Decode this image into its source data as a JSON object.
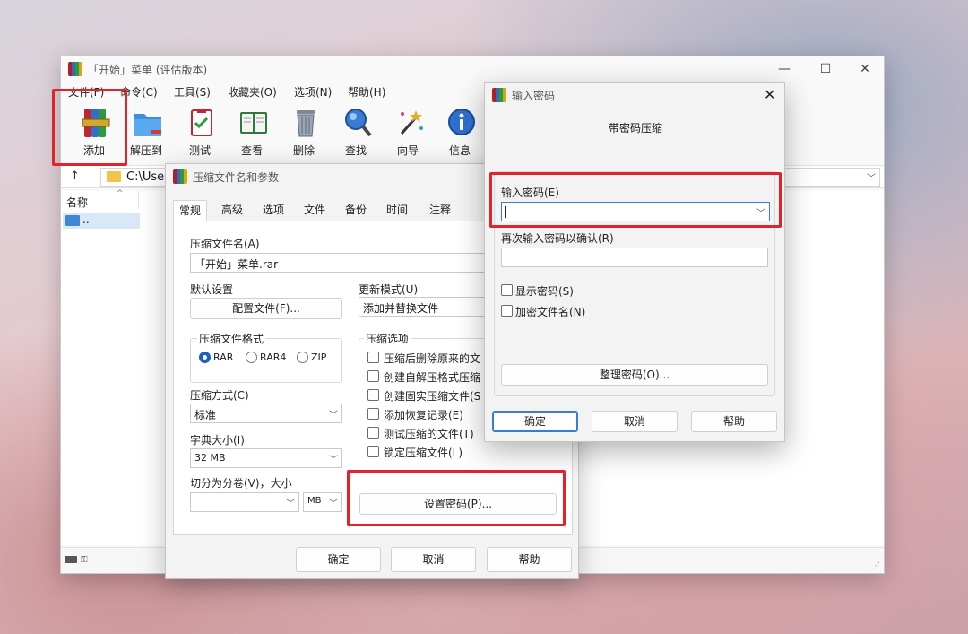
{
  "main_window": {
    "title": "「开始」菜单 (评估版本)",
    "caption": {
      "minimize": "—",
      "maximize": "☐",
      "close": "✕"
    },
    "menu": [
      "文件(F)",
      "命令(C)",
      "工具(S)",
      "收藏夹(O)",
      "选项(N)",
      "帮助(H)"
    ],
    "toolbar": [
      {
        "label": "添加",
        "icon": "add-archive-icon"
      },
      {
        "label": "解压到",
        "icon": "extract-folder-icon"
      },
      {
        "label": "测试",
        "icon": "test-icon"
      },
      {
        "label": "查看",
        "icon": "view-book-icon"
      },
      {
        "label": "删除",
        "icon": "trash-icon"
      },
      {
        "label": "查找",
        "icon": "magnifier-icon"
      },
      {
        "label": "向导",
        "icon": "wizard-wand-icon"
      },
      {
        "label": "信息",
        "icon": "info-icon"
      }
    ],
    "up_arrow": "↑",
    "address": "C:\\Use",
    "file_list": {
      "column_name": "名称",
      "rows": [
        ".."
      ]
    }
  },
  "archive_dialog": {
    "title": "压缩文件名和参数",
    "tabs": [
      "常规",
      "高级",
      "选项",
      "文件",
      "备份",
      "时间",
      "注释"
    ],
    "archive_name_label": "压缩文件名(A)",
    "archive_name_value": "「开始」菜单.rar",
    "default_settings_label": "默认设置",
    "profiles_button": "配置文件(F)...",
    "update_mode_label": "更新模式(U)",
    "update_mode_value": "添加并替换文件",
    "format_group_label": "压缩文件格式",
    "formats": [
      {
        "label": "RAR",
        "selected": true
      },
      {
        "label": "RAR4",
        "selected": false
      },
      {
        "label": "ZIP",
        "selected": false
      }
    ],
    "method_label": "压缩方式(C)",
    "method_value": "标准",
    "dict_label": "字典大小(I)",
    "dict_value": "32 MB",
    "split_label": "切分为分卷(V)，大小",
    "split_value": "",
    "split_unit": "MB",
    "options_group_label": "压缩选项",
    "options": [
      {
        "label": "压缩后删除原来的文",
        "checked": false
      },
      {
        "label": "创建自解压格式压缩",
        "checked": false
      },
      {
        "label": "创建固实压缩文件(S",
        "checked": false
      },
      {
        "label": "添加恢复记录(E)",
        "checked": false
      },
      {
        "label": "测试压缩的文件(T)",
        "checked": false
      },
      {
        "label": "锁定压缩文件(L)",
        "checked": false
      }
    ],
    "set_password_button": "设置密码(P)...",
    "ok": "确定",
    "cancel": "取消",
    "help": "帮助"
  },
  "password_dialog": {
    "title": "输入密码",
    "heading": "带密码压缩",
    "enter_label": "输入密码(E)",
    "enter_value": "",
    "confirm_label": "再次输入密码以确认(R)",
    "confirm_value": "",
    "show_password": {
      "label": "显示密码(S)",
      "checked": false
    },
    "encrypt_names": {
      "label": "加密文件名(N)",
      "checked": false
    },
    "organize_button": "整理密码(O)...",
    "ok": "确定",
    "cancel": "取消",
    "help": "帮助",
    "close": "✕"
  },
  "highlight_color": "#e0242c",
  "accent_color": "#1a5fc4"
}
